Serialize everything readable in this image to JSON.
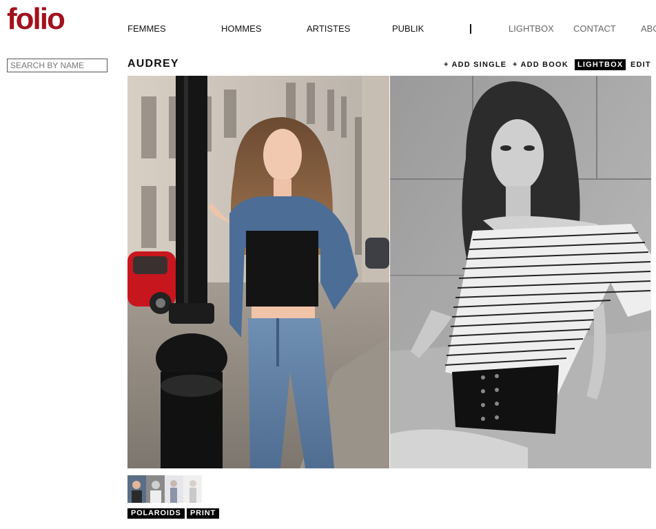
{
  "brand": {
    "logo_text": "folio",
    "color": "#a1121c"
  },
  "nav": {
    "femmes": "FEMMES",
    "hommes": "HOMMES",
    "artistes": "ARTISTES",
    "publik": "PUBLIK",
    "lightbox": "LIGHTBOX",
    "contact": "CONTACT",
    "about": "ABOUT"
  },
  "search": {
    "placeholder": "SEARCH BY NAME"
  },
  "model": {
    "name": "AUDREY"
  },
  "actions": {
    "add_single": "+ ADD SINGLE",
    "add_book": "+ ADD BOOK",
    "lightbox": "LIGHTBOX",
    "edit": "EDIT"
  },
  "tags": {
    "polaroids": "POLAROIDS",
    "print": "PRINT"
  },
  "thumbnails": [
    {
      "icon": "portrait-thumbnail-street"
    },
    {
      "icon": "portrait-thumbnail-bw"
    },
    {
      "icon": "portrait-thumbnail-faded"
    },
    {
      "icon": "portrait-thumbnail-light"
    }
  ]
}
